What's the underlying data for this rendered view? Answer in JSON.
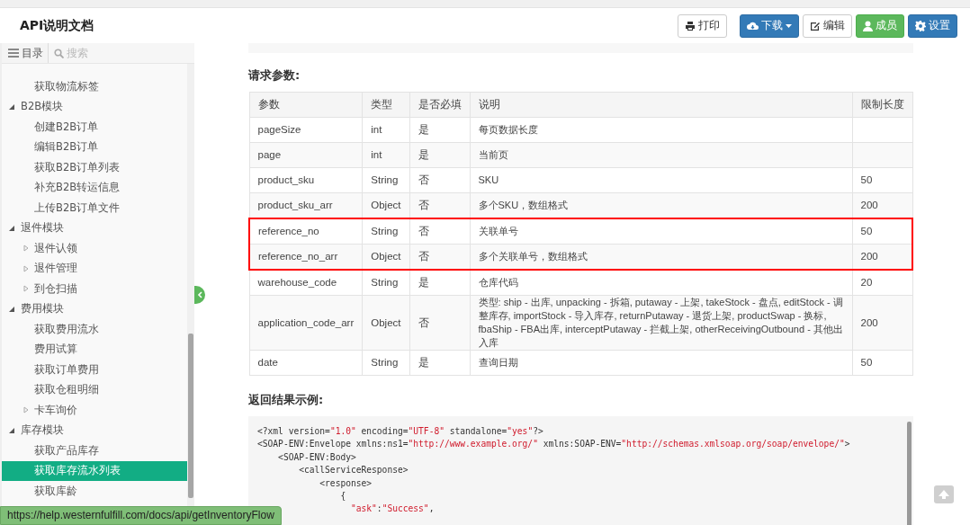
{
  "header": {
    "title": "API说明文档",
    "buttons": [
      {
        "label": "打印"
      },
      {
        "label": "下载"
      },
      {
        "label": "编辑"
      },
      {
        "label": "成员"
      },
      {
        "label": "设置"
      }
    ]
  },
  "sidebar": {
    "tab": "目录",
    "search": {
      "placeholder": "搜索"
    },
    "items": [
      {
        "label": "获取物流标签",
        "selected": false
      },
      {
        "label": "B2B模块",
        "expanded": true,
        "children": [
          {
            "label": "创建B2B订单",
            "selected": false
          },
          {
            "label": "编辑B2B订单",
            "selected": false
          },
          {
            "label": "获取B2B订单列表",
            "selected": false
          },
          {
            "label": "补充B2B转运信息",
            "selected": false
          },
          {
            "label": "上传B2B订单文件",
            "selected": false
          }
        ]
      },
      {
        "label": "退件模块",
        "expanded": true,
        "children": [
          {
            "label": "退件认领",
            "selected": false,
            "expanded": false
          },
          {
            "label": "退件管理",
            "selected": false,
            "expanded": false
          },
          {
            "label": "到仓扫描",
            "selected": false,
            "expanded": false
          }
        ]
      },
      {
        "label": "费用模块",
        "expanded": true,
        "children": [
          {
            "label": "获取费用流水",
            "selected": false
          },
          {
            "label": "费用试算",
            "selected": false
          },
          {
            "label": "获取订单费用",
            "selected": false
          },
          {
            "label": "获取仓租明细",
            "selected": false
          },
          {
            "label": "卡车询价",
            "selected": false,
            "expanded": false
          }
        ]
      },
      {
        "label": "库存模块",
        "expanded": true,
        "children": [
          {
            "label": "获取产品库存",
            "selected": false
          },
          {
            "label": "获取库存流水列表",
            "selected": true
          },
          {
            "label": "获取库龄",
            "selected": false
          }
        ]
      }
    ]
  },
  "status_url": "https://help.westernfulfill.com/docs/api/getInventoryFlow",
  "request": {
    "heading": "请求参数:",
    "columns": [
      "参数",
      "类型",
      "是否必填",
      "说明",
      "限制长度"
    ],
    "rows": [
      {
        "cells": [
          "pageSize",
          "int",
          "是",
          "每页数据长度",
          ""
        ],
        "highlighted": false
      },
      {
        "cells": [
          "page",
          "int",
          "是",
          "当前页",
          ""
        ],
        "highlighted": false
      },
      {
        "cells": [
          "product_sku",
          "String",
          "否",
          "SKU",
          "50"
        ],
        "highlighted": false
      },
      {
        "cells": [
          "product_sku_arr",
          "Object",
          "否",
          "多个SKU，数组格式",
          "200"
        ],
        "highlighted": false
      },
      {
        "cells": [
          "reference_no",
          "String",
          "否",
          "关联单号",
          "50"
        ],
        "highlighted": true
      },
      {
        "cells": [
          "reference_no_arr",
          "Object",
          "否",
          "多个关联单号，数组格式",
          "200"
        ],
        "highlighted": true
      },
      {
        "cells": [
          "warehouse_code",
          "String",
          "是",
          "仓库代码",
          "20"
        ],
        "highlighted": false
      },
      {
        "cells": [
          "application_code_arr",
          "Object",
          "否",
          "类型: ship - 出库, unpacking - 拆箱, putaway - 上架, takeStock - 盘点, editStock - 调整库存, importStock - 导入库存, returnPutaway - 退货上架, productSwap - 换标, fbaShip - FBA出库, interceptPutaway - 拦截上架, otherReceivingOutbound - 其他出入库",
          "200"
        ],
        "highlighted": false
      },
      {
        "cells": [
          "date",
          "String",
          "是",
          "查询日期",
          "50"
        ],
        "highlighted": false
      }
    ]
  },
  "response": {
    "heading": "返回结果示例:",
    "code": [
      [
        {
          "text": "<?xml version=",
          "kind": "plain"
        },
        {
          "text": "\"1.0\"",
          "kind": "string"
        },
        {
          "text": " encoding=",
          "kind": "plain"
        },
        {
          "text": "\"UTF-8\"",
          "kind": "string"
        },
        {
          "text": " standalone=",
          "kind": "plain"
        },
        {
          "text": "\"yes\"",
          "kind": "string"
        },
        {
          "text": "?>",
          "kind": "plain"
        }
      ],
      [
        {
          "text": "<SOAP-ENV:Envelope xmlns:ns1=",
          "kind": "plain"
        },
        {
          "text": "\"http://www.example.org/\"",
          "kind": "string"
        },
        {
          "text": " xmlns:SOAP-ENV=",
          "kind": "plain"
        },
        {
          "text": "\"http://schemas.xmlsoap.org/soap/envelope/\"",
          "kind": "string"
        },
        {
          "text": ">",
          "kind": "plain"
        }
      ],
      [
        {
          "text": "    <SOAP-ENV:Body>",
          "kind": "plain"
        }
      ],
      [
        {
          "text": "        <callServiceResponse>",
          "kind": "plain"
        }
      ],
      [
        {
          "text": "            <response>",
          "kind": "plain"
        }
      ],
      [
        {
          "text": "                {",
          "kind": "plain"
        }
      ],
      [
        {
          "text": "                  \"ask\"",
          "kind": "string"
        },
        {
          "text": ":",
          "kind": "plain"
        },
        {
          "text": "\"Success\"",
          "kind": "string"
        },
        {
          "text": ",",
          "kind": "plain"
        }
      ]
    ]
  }
}
